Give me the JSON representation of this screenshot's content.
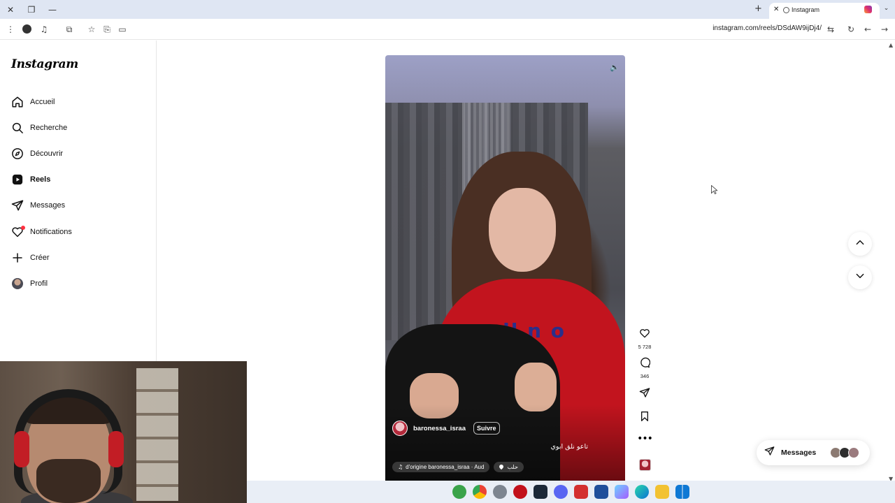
{
  "browser": {
    "tab_title": "Instagram",
    "url": "instagram.com/reels/DSdAW9ijDj4/"
  },
  "sidebar": {
    "logo": "Instagram",
    "items": [
      {
        "label": "Accueil",
        "icon": "home-icon"
      },
      {
        "label": "Recherche",
        "icon": "search-icon"
      },
      {
        "label": "Découvrir",
        "icon": "compass-icon"
      },
      {
        "label": "Reels",
        "icon": "reels-icon",
        "active": true
      },
      {
        "label": "Messages",
        "icon": "send-icon"
      },
      {
        "label": "Notifications",
        "icon": "heart-icon"
      },
      {
        "label": "Créer",
        "icon": "plus-icon"
      },
      {
        "label": "Profil",
        "icon": "avatar"
      }
    ]
  },
  "reel": {
    "username": "baronessa_israa",
    "follow_label": "Suivre",
    "caption": "تاعو نلق ابوي",
    "audio_label": "d'origine  baronessa_israa · Aud",
    "location": "حلب",
    "sweater_print": "noll n o"
  },
  "actions": {
    "likes": "5 728",
    "comments": "346"
  },
  "messages_pill": {
    "label": "Messages"
  },
  "colors": {
    "accent_notification": "#ff3040",
    "browser_tabbar": "#dfe6f3",
    "taskbar": "#e9eef6"
  }
}
